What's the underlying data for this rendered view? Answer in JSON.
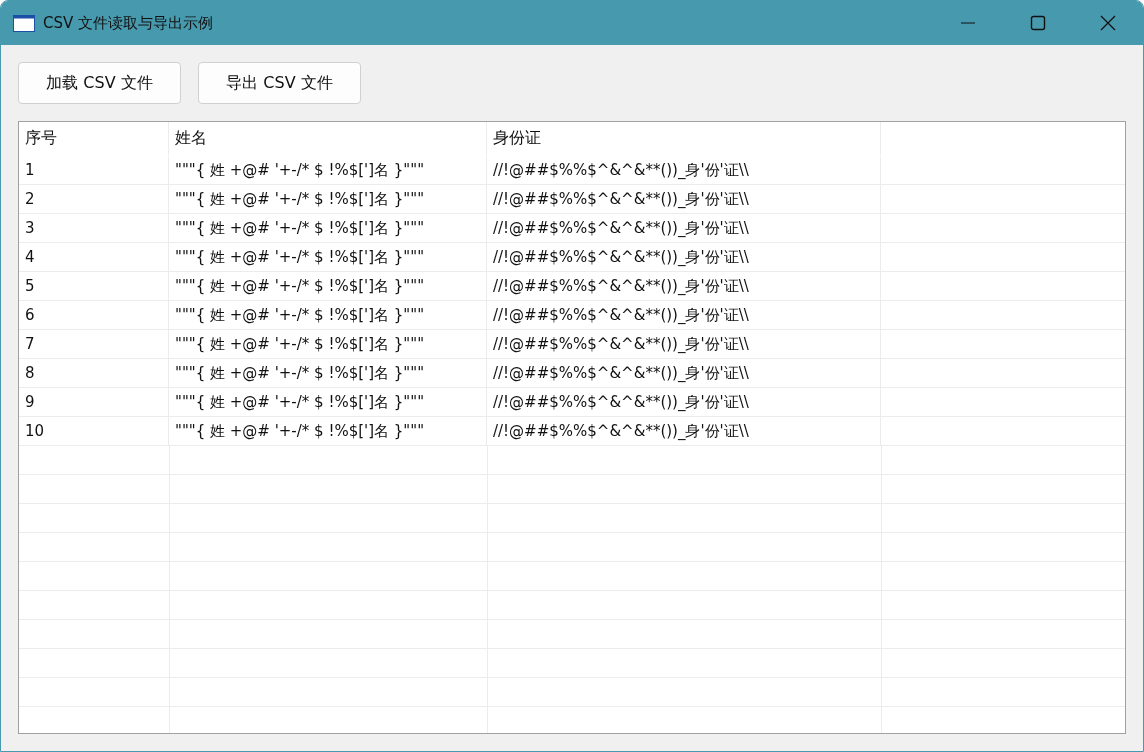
{
  "window": {
    "title": "CSV 文件读取与导出示例"
  },
  "toolbar": {
    "buttons": [
      "加载 CSV 文件",
      "导出 CSV 文件"
    ]
  },
  "table": {
    "columns": [
      "序号",
      "姓名",
      "身份证"
    ],
    "rows": [
      [
        "1",
        "\"\"\"{ 姓 +@# '+-/* $ !%$[']名 }\"\"\"",
        "//!@##$%%$^&^&**())_身'份'证\\\\"
      ],
      [
        "2",
        "\"\"\"{ 姓 +@# '+-/* $ !%$[']名 }\"\"\"",
        "//!@##$%%$^&^&**())_身'份'证\\\\"
      ],
      [
        "3",
        "\"\"\"{ 姓 +@# '+-/* $ !%$[']名 }\"\"\"",
        "//!@##$%%$^&^&**())_身'份'证\\\\"
      ],
      [
        "4",
        "\"\"\"{ 姓 +@# '+-/* $ !%$[']名 }\"\"\"",
        "//!@##$%%$^&^&**())_身'份'证\\\\"
      ],
      [
        "5",
        "\"\"\"{ 姓 +@# '+-/* $ !%$[']名 }\"\"\"",
        "//!@##$%%$^&^&**())_身'份'证\\\\"
      ],
      [
        "6",
        "\"\"\"{ 姓 +@# '+-/* $ !%$[']名 }\"\"\"",
        "//!@##$%%$^&^&**())_身'份'证\\\\"
      ],
      [
        "7",
        "\"\"\"{ 姓 +@# '+-/* $ !%$[']名 }\"\"\"",
        "//!@##$%%$^&^&**())_身'份'证\\\\"
      ],
      [
        "8",
        "\"\"\"{ 姓 +@# '+-/* $ !%$[']名 }\"\"\"",
        "//!@##$%%$^&^&**())_身'份'证\\\\"
      ],
      [
        "9",
        "\"\"\"{ 姓 +@# '+-/* $ !%$[']名 }\"\"\"",
        "//!@##$%%$^&^&**())_身'份'证\\\\"
      ],
      [
        "10",
        "\"\"\"{ 姓 +@# '+-/* $ !%$[']名 }\"\"\"",
        "//!@##$%%$^&^&**())_身'份'证\\\\"
      ]
    ]
  }
}
